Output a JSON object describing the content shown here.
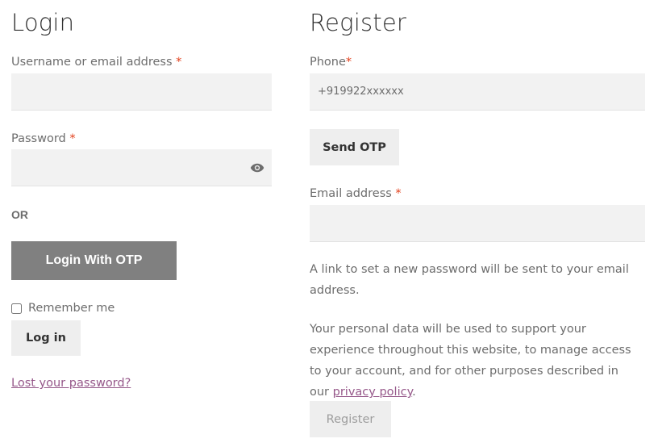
{
  "login": {
    "title": "Login",
    "username_label": "Username or email address",
    "required_mark": "*",
    "username_value": "",
    "password_label": "Password",
    "password_value": "",
    "or_text": "OR",
    "otp_button": "Login With OTP",
    "remember_label": "Remember me",
    "login_button": "Log in",
    "lost_password": "Lost your password?",
    "toggle_icon": "eye-icon"
  },
  "register": {
    "title": "Register",
    "phone_label": "Phone",
    "phone_placeholder": "+919922xxxxxx",
    "send_otp_button": "Send OTP",
    "email_label": "Email address",
    "email_value": "",
    "password_notice": "A link to set a new password will be sent to your email address.",
    "privacy_text_before": "Your personal data will be used to support your experience throughout this website, to manage access to your account, and for other purposes described in our ",
    "privacy_link": "privacy policy",
    "privacy_text_after": ".",
    "register_button": "Register"
  },
  "colors": {
    "required": "#e2401c",
    "link": "#96588a",
    "otp_button_bg": "#808080",
    "field_bg": "#f2f2f2"
  }
}
